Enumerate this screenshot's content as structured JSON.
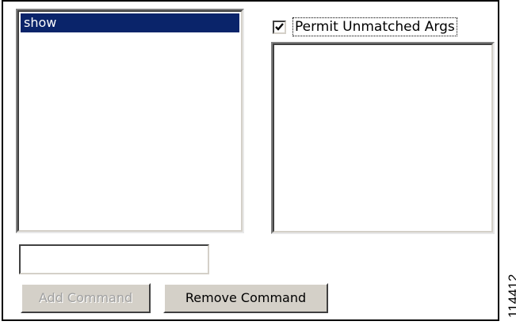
{
  "command_list": {
    "items": [
      "show"
    ],
    "selected": "show"
  },
  "permit_unmatched_args": {
    "label": "Permit Unmatched Args",
    "checked": true
  },
  "args_list": {
    "items": []
  },
  "command_input": {
    "value": "",
    "placeholder": ""
  },
  "buttons": {
    "add_label": "Add Command",
    "remove_label": "Remove Command"
  },
  "figure_id": "114412",
  "colors": {
    "selection_bg": "#0a246a",
    "button_face": "#d4d0c8",
    "disabled_text": "#a0a0a0"
  }
}
